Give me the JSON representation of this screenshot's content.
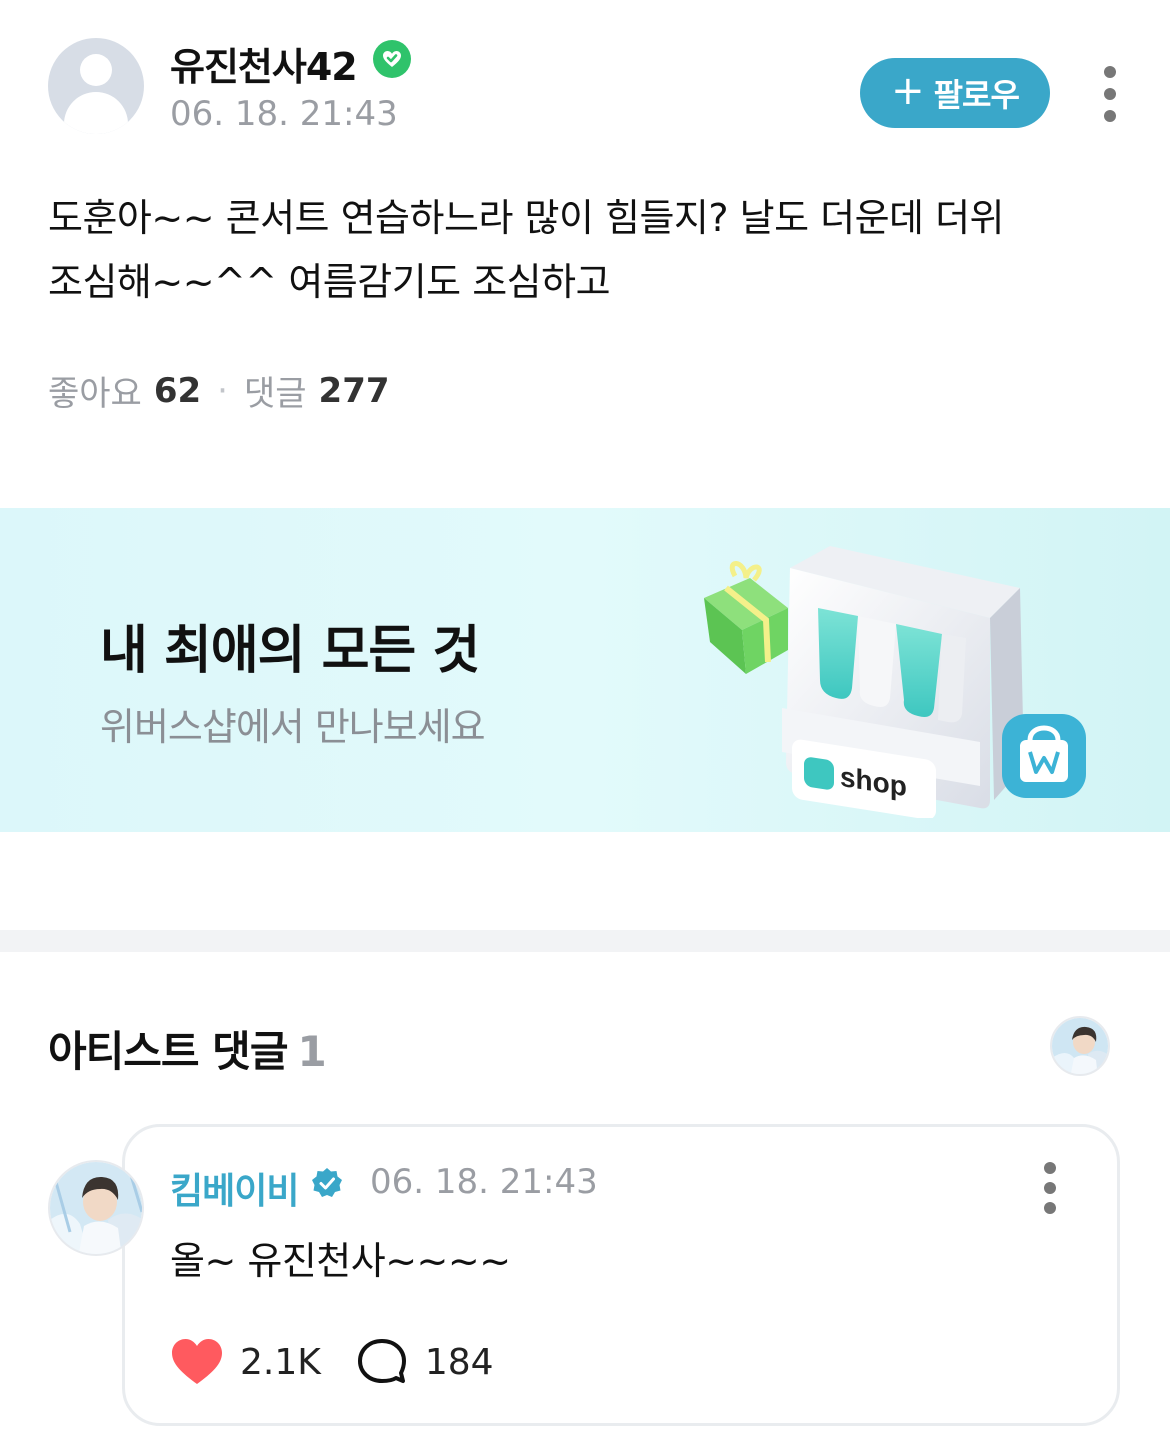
{
  "post": {
    "author_name": "유진천사42",
    "timestamp": "06. 18. 21:43",
    "follow_label": "팔로우",
    "follow_icon": "+",
    "body_line1": "도훈아~~ 콘서트 연습하느라 많이 힘들지? 날도 더운데 더위",
    "body_line2": "조심해~~^^ 여름감기도 조심하고",
    "likes_label": "좋아요",
    "likes_count": "62",
    "comments_label": "댓글",
    "comments_count": "277",
    "separator": "·"
  },
  "banner": {
    "title": "내 최애의 모든 것",
    "subtitle": "위버스샵에서 만나보세요",
    "shop_label": "shop"
  },
  "artist_comments": {
    "heading": "아티스트 댓글",
    "count": "1",
    "comment": {
      "author_name": "킴베이비",
      "timestamp": "06. 18. 21:43",
      "text": "올~ 유진천사~~~~",
      "likes": "2.1K",
      "replies": "184"
    }
  },
  "colors": {
    "accent": "#3aa7c9",
    "verified_green": "#2fc36b",
    "heart": "#ff5a5f",
    "muted_text": "#9a9da3"
  },
  "icons": {
    "verified_badge": "verified-green-heart",
    "artist_badge": "verified-blue-check",
    "more": "more-vertical",
    "like": "heart",
    "reply": "speech-bubble"
  }
}
